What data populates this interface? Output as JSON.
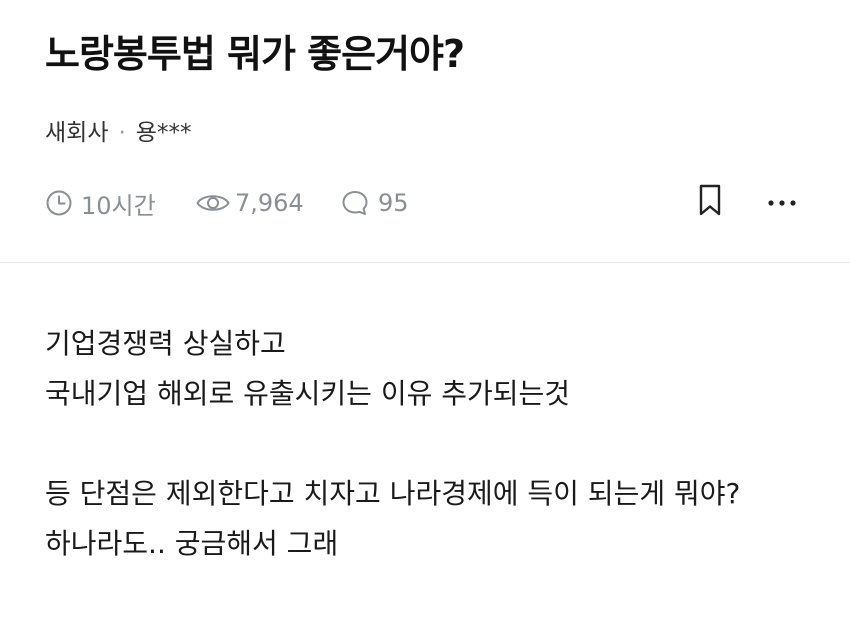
{
  "post": {
    "title": "노랑봉투법 뭐가 좋은거야?",
    "category": "새회사",
    "separator": "·",
    "author": "용***"
  },
  "stats": {
    "time": "10시간",
    "views": "7,964",
    "comments": "95"
  },
  "icons": {
    "time": "clock-icon",
    "views": "eye-icon",
    "comments": "comment-bubble-icon",
    "bookmark": "bookmark-icon",
    "more": "more-dots-icon",
    "muted_color": "#8a8f95"
  },
  "content": {
    "lines": [
      "기업경쟁력 상실하고",
      "국내기업 해외로 유출시키는 이유 추가되는것",
      "",
      "등 단점은 제외한다고 치자고 나라경제에 득이 되는게 뭐야?",
      "하나라도.. 궁금해서 그래"
    ]
  }
}
